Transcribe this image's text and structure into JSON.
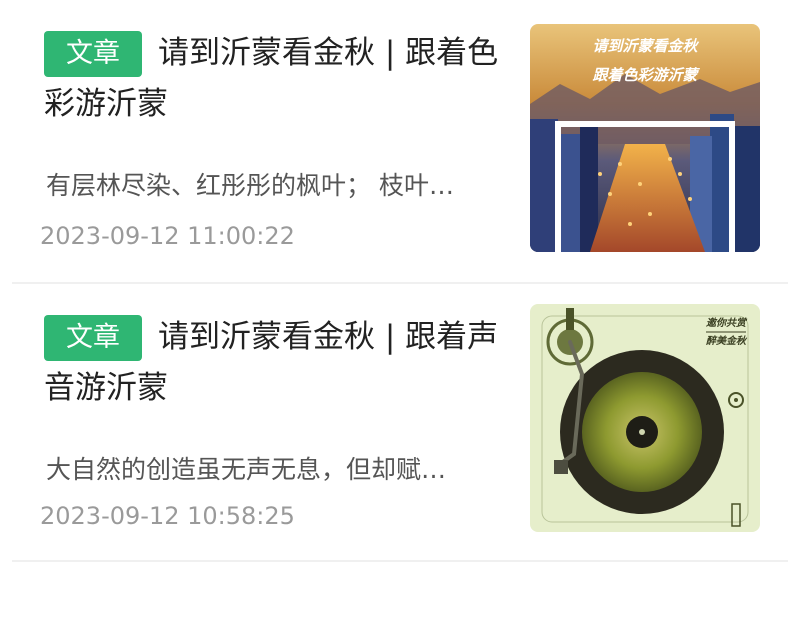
{
  "articles": [
    {
      "badge": "文章",
      "title": "请到沂蒙看金秋 | 跟着色彩游沂蒙",
      "summary": "有层林尽染、红彤彤的枫叶； 枝叶…",
      "date": "2023-09-12 11:00:22",
      "thumbnail": {
        "line1": "请到沂蒙看金秋",
        "line2": "跟着色彩游沂蒙",
        "colors": {
          "sky": "#d7a64a",
          "city": "#3a5fa0",
          "frame": "#ffffff"
        }
      }
    },
    {
      "badge": "文章",
      "title": "请到沂蒙看金秋 | 跟着声音游沂蒙",
      "summary": "大自然的创造虽无声无息，但却赋…",
      "date": "2023-09-12 10:58:25",
      "thumbnail": {
        "line1": "邀你共赏",
        "line2": "醉美金秋",
        "colors": {
          "background": "#e8efcf",
          "record": "#2a2a1e",
          "leaf": "#8c9a2c"
        }
      }
    }
  ]
}
